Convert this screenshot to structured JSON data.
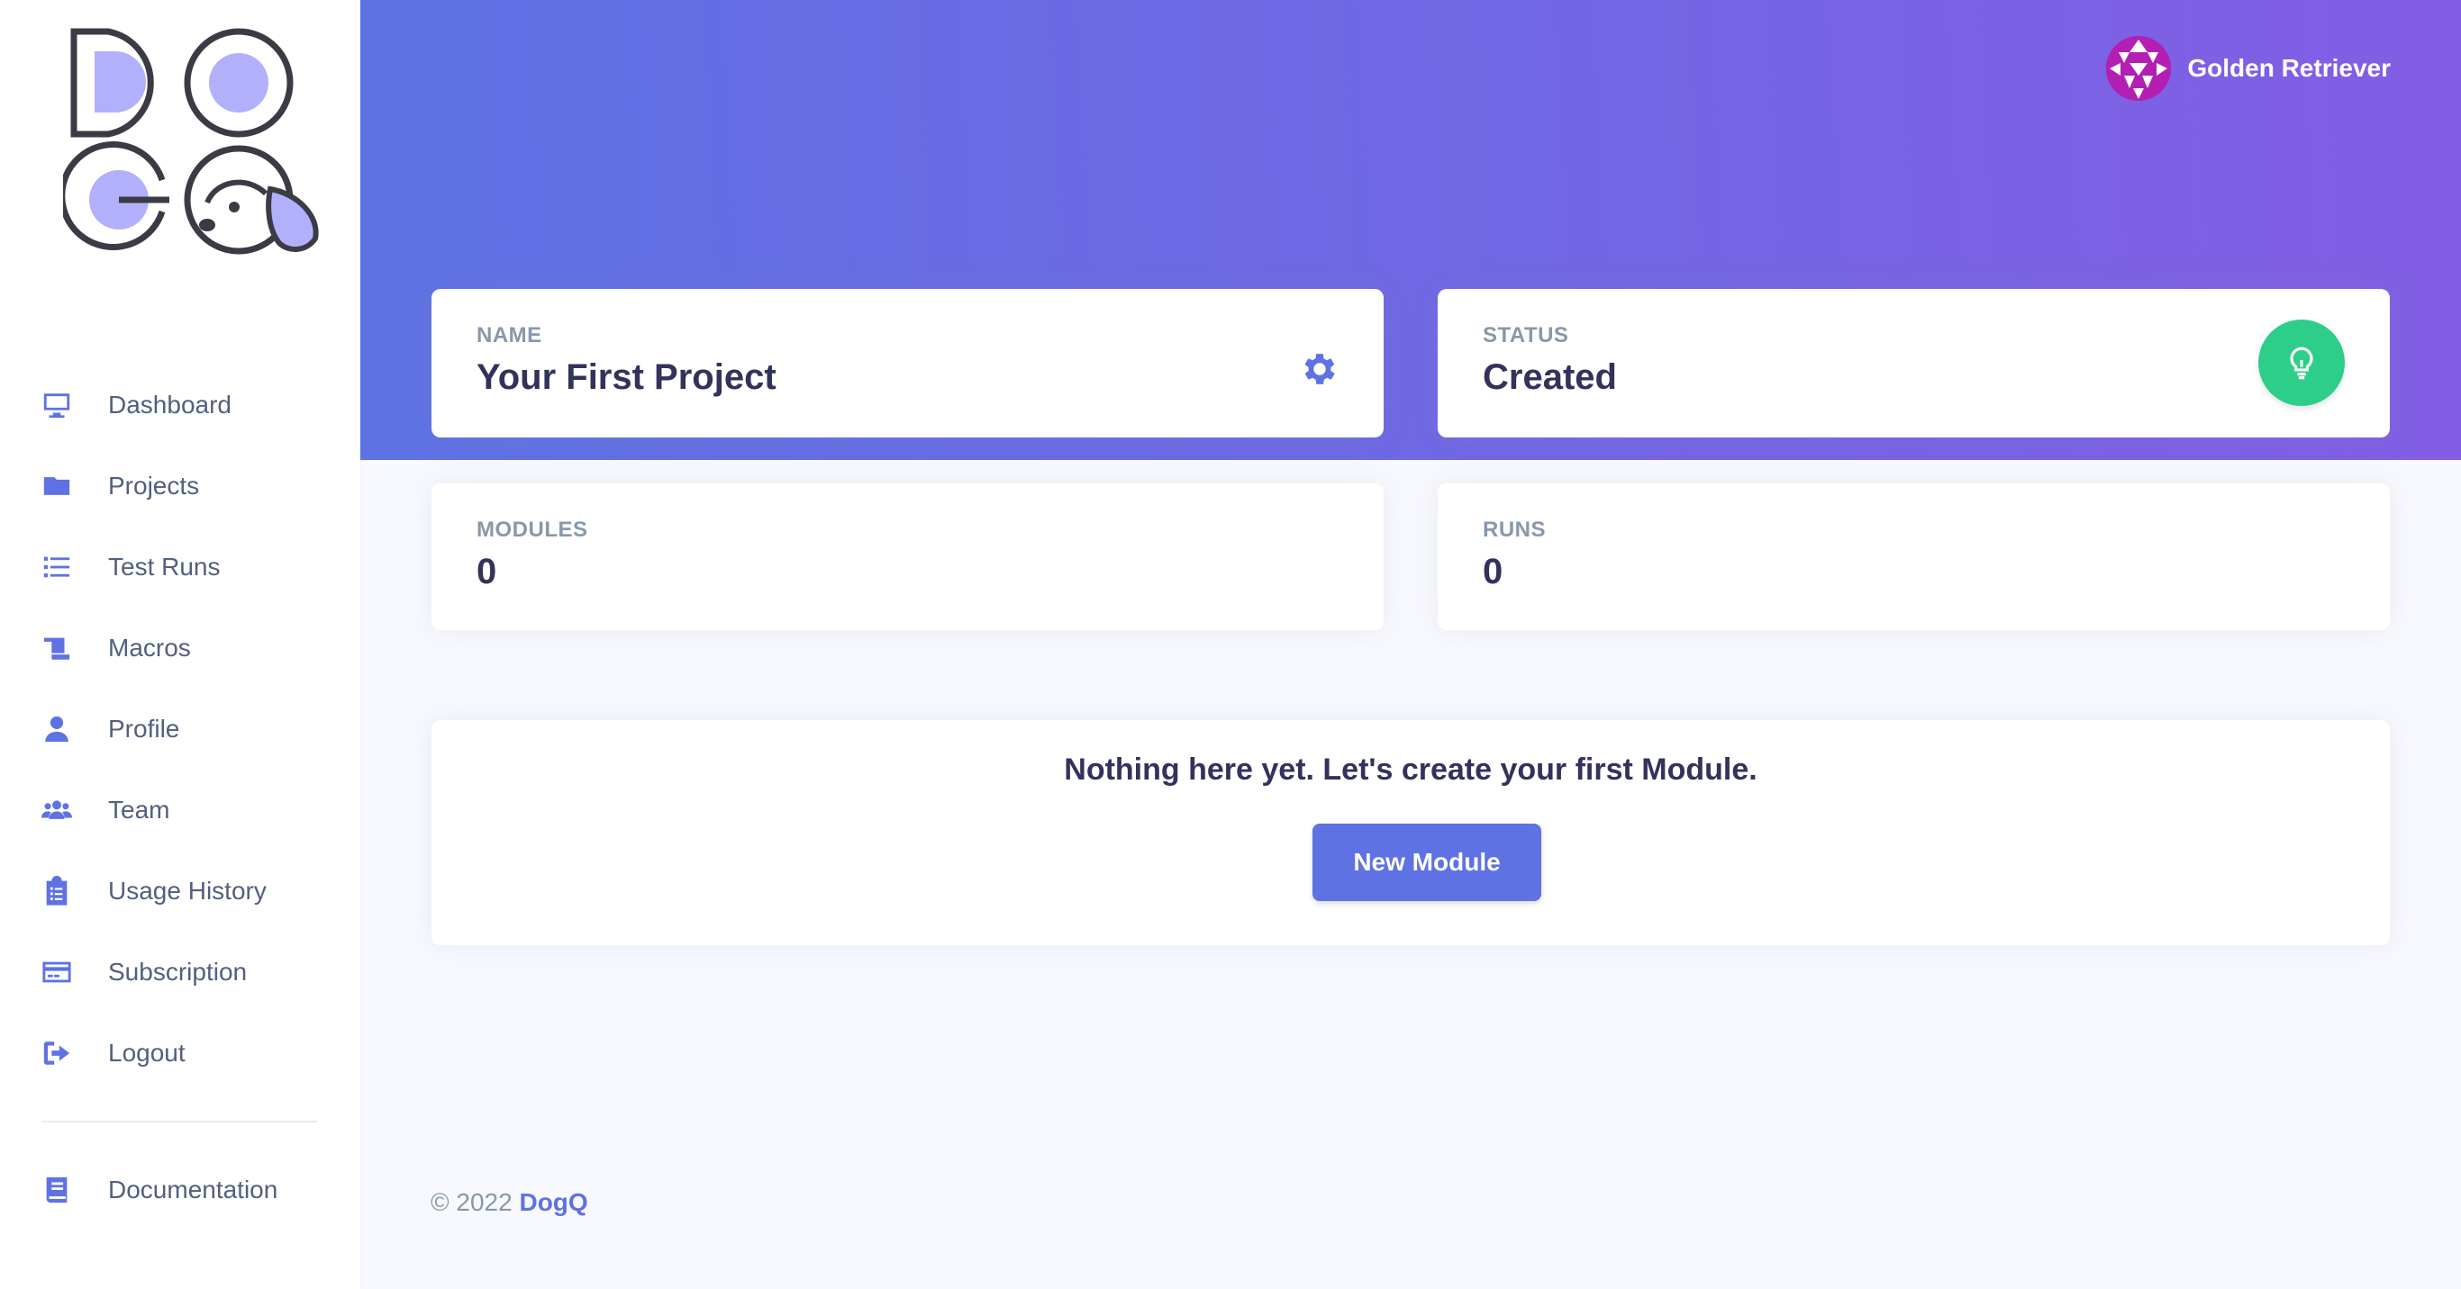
{
  "sidebar": {
    "items": [
      {
        "label": "Dashboard",
        "icon": "desktop-icon"
      },
      {
        "label": "Projects",
        "icon": "folder-icon"
      },
      {
        "label": "Test Runs",
        "icon": "list-icon"
      },
      {
        "label": "Macros",
        "icon": "scroll-icon"
      },
      {
        "label": "Profile",
        "icon": "user-icon"
      },
      {
        "label": "Team",
        "icon": "users-icon"
      },
      {
        "label": "Usage History",
        "icon": "clipboard-icon"
      },
      {
        "label": "Subscription",
        "icon": "credit-card-icon"
      },
      {
        "label": "Logout",
        "icon": "logout-icon"
      }
    ],
    "documentation": {
      "label": "Documentation",
      "icon": "book-icon"
    }
  },
  "header": {
    "user_name": "Golden Retriever"
  },
  "cards": {
    "name": {
      "title": "NAME",
      "value": "Your First Project"
    },
    "status": {
      "title": "STATUS",
      "value": "Created"
    },
    "modules": {
      "title": "MODULES",
      "value": "0"
    },
    "runs": {
      "title": "RUNS",
      "value": "0"
    }
  },
  "empty_state": {
    "message": "Nothing here yet. Let's create your first Module.",
    "button_label": "New Module"
  },
  "footer": {
    "copyright": "© 2022",
    "brand": "DogQ"
  },
  "colors": {
    "primary": "#5e72e4",
    "gradient_end": "#825ee4",
    "success": "#2dce89",
    "heading": "#32325d",
    "muted": "#8898aa"
  }
}
